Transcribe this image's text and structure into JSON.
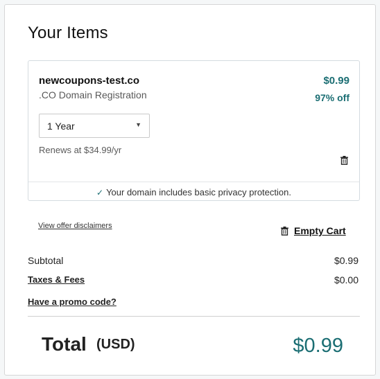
{
  "section_title": "Your Items",
  "item": {
    "domain": "newcoupons-test.co",
    "description": ".CO Domain Registration",
    "price": "$0.99",
    "discount": "97% off",
    "term": {
      "selected": "1 Year"
    },
    "renewal": "Renews at $34.99/yr",
    "privacy_note": "Your domain includes basic privacy protection."
  },
  "actions": {
    "disclaimers_label": "View offer disclaimers",
    "empty_cart_label": "Empty Cart"
  },
  "summary": {
    "subtotal_label": "Subtotal",
    "subtotal_value": "$0.99",
    "taxes_label": "Taxes & Fees",
    "taxes_value": "$0.00",
    "promo_label": "Have a promo code?"
  },
  "total": {
    "label": "Total",
    "currency": "(USD)",
    "value": "$0.99"
  },
  "colors": {
    "accent": "#1b6e73",
    "border": "#d4dbe0"
  }
}
